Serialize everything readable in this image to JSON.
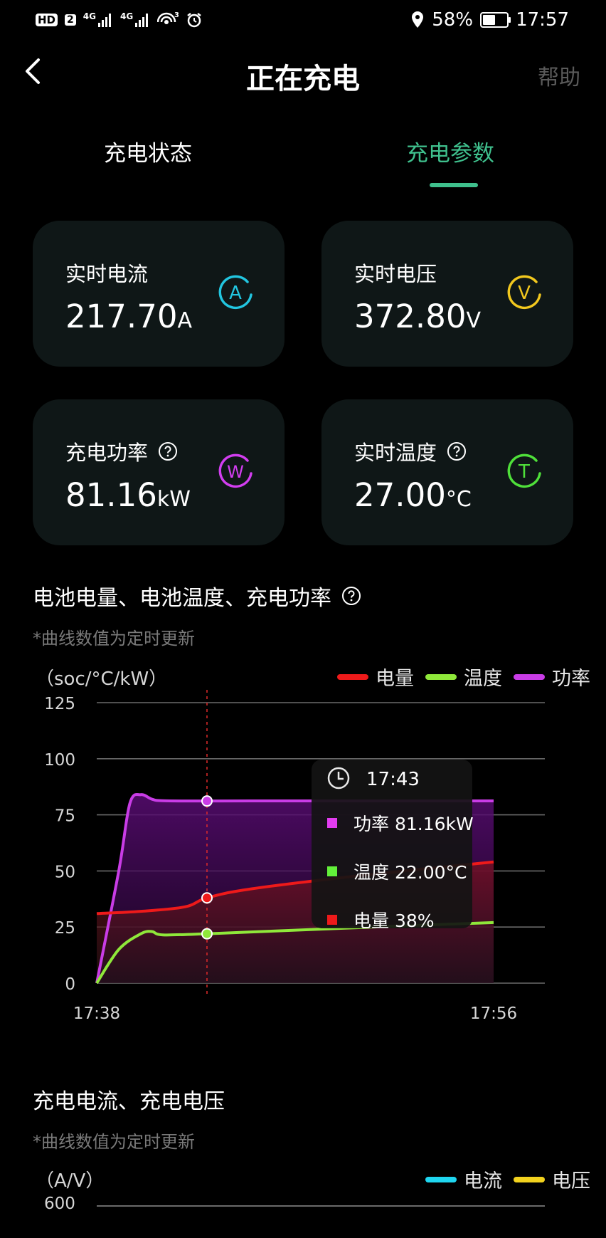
{
  "status_bar": {
    "left_icons": [
      "hd-icon",
      "sim2-icon",
      "signal-4g-icon",
      "signal-4g-icon",
      "wifi-hotspot-icon",
      "alarm-icon"
    ],
    "hd": "HD",
    "sim": "2",
    "net1": "4G",
    "net2": "4G",
    "battery_percent": "58%",
    "battery_level": 0.58,
    "time": "17:57"
  },
  "header": {
    "title": "正在充电",
    "help": "帮助"
  },
  "tabs": [
    {
      "label": "充电状态",
      "active": false
    },
    {
      "label": "充电参数",
      "active": true
    }
  ],
  "cards": {
    "current": {
      "label": "实时电流",
      "value": "217.70",
      "unit": "A",
      "icon_letter": "A",
      "color": "#22c6e0"
    },
    "voltage": {
      "label": "实时电压",
      "value": "372.80",
      "unit": "V",
      "icon_letter": "V",
      "color": "#f2c81e"
    },
    "power": {
      "label": "充电功率",
      "value": "81.16",
      "unit": "kW",
      "icon_letter": "W",
      "color": "#d23ef0"
    },
    "temperature": {
      "label": "实时温度",
      "value": "27.00",
      "unit": "°C",
      "icon_letter": "T",
      "color": "#4fe03a"
    }
  },
  "chart1": {
    "title": "电池电量、电池温度、充电功率",
    "note": "*曲线数值为定时更新",
    "unit_label": "（soc/°C/kW）",
    "legend": [
      {
        "name": "电量",
        "color": "#ee1a1a"
      },
      {
        "name": "温度",
        "color": "#8fe83a"
      },
      {
        "name": "功率",
        "color": "#c93ce6"
      }
    ],
    "tooltip": {
      "time": "17:43",
      "rows": [
        {
          "label": "功率 81.16kW",
          "color": "#e23cf0"
        },
        {
          "label": "温度 22.00°C",
          "color": "#63f03a"
        },
        {
          "label": "电量 38%",
          "color": "#ee1a1a"
        }
      ]
    }
  },
  "chart2": {
    "title": "充电电流、充电电压",
    "note": "*曲线数值为定时更新",
    "unit_label": "（A/V）",
    "legend": [
      {
        "name": "电流",
        "color": "#1fd6f0"
      },
      {
        "name": "电压",
        "color": "#f2d21e"
      }
    ],
    "y_top_label": "600"
  },
  "chart_data": [
    {
      "type": "area",
      "title": "电池电量、电池温度、充电功率",
      "ylabel": "（soc/°C/kW）",
      "ylim": [
        0,
        125
      ],
      "yticks": [
        0,
        25,
        50,
        75,
        100,
        125
      ],
      "xlim": [
        "17:38",
        "17:56"
      ],
      "xticks": [
        "17:38",
        "17:56"
      ],
      "grid": true,
      "legend_position": "top-right",
      "highlight_x": "17:43",
      "series": [
        {
          "name": "功率",
          "color": "#c93ce6",
          "x": [
            "17:38",
            "17:39",
            "17:39:30",
            "17:40",
            "17:40:30",
            "17:41",
            "17:43",
            "17:45",
            "17:50",
            "17:56"
          ],
          "y": [
            0,
            50,
            80,
            84,
            82,
            81.3,
            81.16,
            81.2,
            81.2,
            81.2
          ]
        },
        {
          "name": "温度",
          "color": "#8fe83a",
          "x": [
            "17:38",
            "17:39",
            "17:40",
            "17:40:30",
            "17:41",
            "17:43",
            "17:45",
            "17:50",
            "17:56"
          ],
          "y": [
            0,
            15,
            22,
            23,
            21.5,
            22,
            22.8,
            24.8,
            27
          ]
        },
        {
          "name": "电量",
          "color": "#ee1a1a",
          "x": [
            "17:38",
            "17:40",
            "17:42",
            "17:43",
            "17:45",
            "17:50",
            "17:56"
          ],
          "y": [
            31,
            32,
            34,
            38,
            42,
            48,
            54
          ]
        }
      ]
    },
    {
      "type": "line",
      "title": "充电电流、充电电压",
      "ylabel": "（A/V）",
      "yticks": [
        600
      ],
      "series": [
        {
          "name": "电流",
          "color": "#1fd6f0"
        },
        {
          "name": "电压",
          "color": "#f2d21e"
        }
      ]
    }
  ]
}
